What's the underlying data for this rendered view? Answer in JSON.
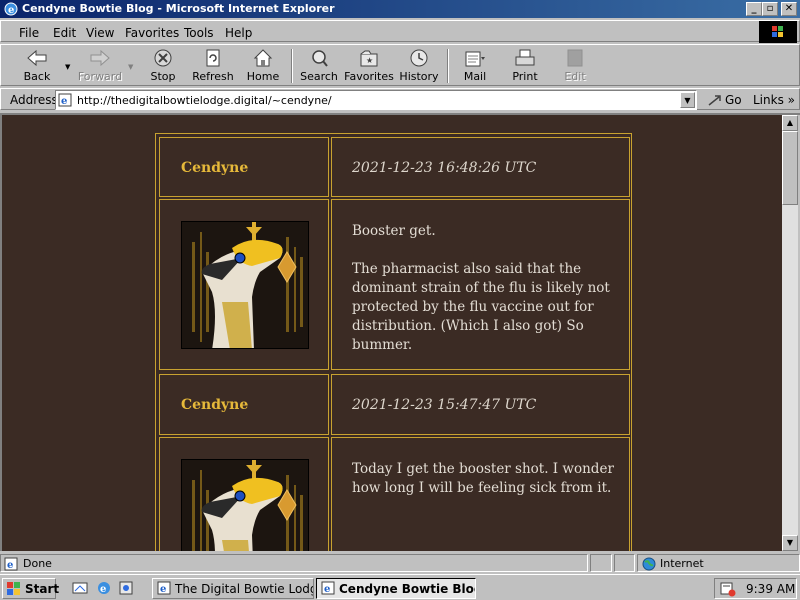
{
  "window": {
    "title": "Cendyne Bowtie Blog - Microsoft Internet Explorer",
    "minimize": "_",
    "maximize": "▫",
    "close": "✕"
  },
  "menu": [
    {
      "label": "File",
      "key": "F"
    },
    {
      "label": "Edit",
      "key": "E"
    },
    {
      "label": "View",
      "key": "V"
    },
    {
      "label": "Favorites",
      "key": "a"
    },
    {
      "label": "Tools",
      "key": "T"
    },
    {
      "label": "Help",
      "key": "H"
    }
  ],
  "toolbar": {
    "back": "Back",
    "forward": "Forward",
    "stop": "Stop",
    "refresh": "Refresh",
    "home": "Home",
    "search": "Search",
    "favorites": "Favorites",
    "history": "History",
    "mail": "Mail",
    "print": "Print",
    "edit": "Edit"
  },
  "address": {
    "label": "Address",
    "url": "http://thedigitalbowtielodge.digital/~cendyne/",
    "go": "Go",
    "links": "Links"
  },
  "posts": [
    {
      "author": "Cendyne",
      "timestamp": "2021-12-23 16:48:26 UTC",
      "paragraphs": [
        "Booster get.",
        "The pharmacist also said that the dominant strain of the flu is likely not protected by the flu vaccine out for distribution. (Which I also got) So bummer."
      ]
    },
    {
      "author": "Cendyne",
      "timestamp": "2021-12-23 15:47:47 UTC",
      "paragraphs": [
        "Today I get the booster shot. I wonder how long I will be feeling sick from it."
      ]
    }
  ],
  "status": {
    "text": "Done",
    "zone": "Internet"
  },
  "taskbar": {
    "start": "Start",
    "tasks": [
      {
        "label": "The Digital Bowtie Lodge -...",
        "active": false
      },
      {
        "label": "Cendyne Bowtie Blog...",
        "active": true
      }
    ],
    "clock": "9:39 AM"
  },
  "colors": {
    "page_bg": "#3b2b24",
    "accent_gold": "#c8a230",
    "author_gold": "#e6b93a",
    "titlebar": "#0a246a"
  }
}
